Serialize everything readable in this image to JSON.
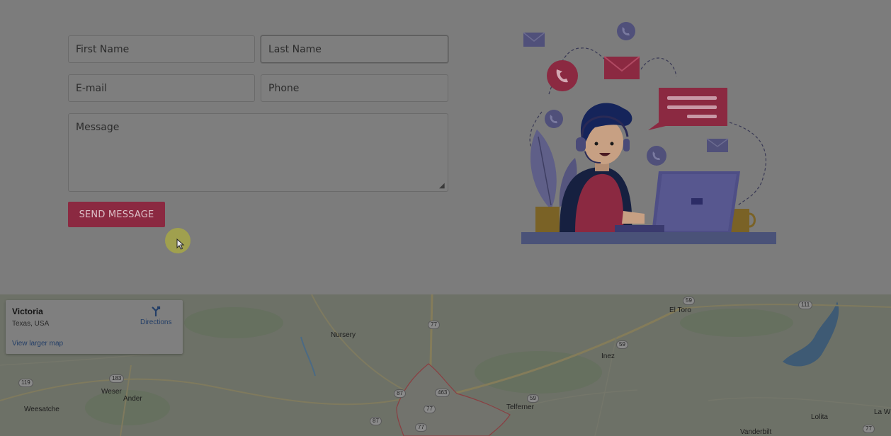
{
  "form": {
    "first_name_placeholder": "First Name",
    "last_name_placeholder": "Last Name",
    "email_placeholder": "E-mail",
    "phone_placeholder": "Phone",
    "message_placeholder": "Message",
    "send_label": "SEND MESSAGE"
  },
  "map": {
    "card": {
      "title": "Victoria",
      "subtitle": "Texas, USA",
      "directions_label": "Directions",
      "view_larger_label": "View larger map"
    },
    "places": [
      "Nursery",
      "El Toro",
      "Inez",
      "Weser",
      "Ander",
      "Weesatche",
      "Telferner",
      "Lolita",
      "Vanderbilt",
      "La W"
    ],
    "highways": [
      "59",
      "111",
      "77",
      "59",
      "183",
      "119",
      "87",
      "463",
      "59",
      "77",
      "87",
      "77",
      "77"
    ]
  },
  "colors": {
    "accent": "#8b2941",
    "link": "#233e67"
  }
}
